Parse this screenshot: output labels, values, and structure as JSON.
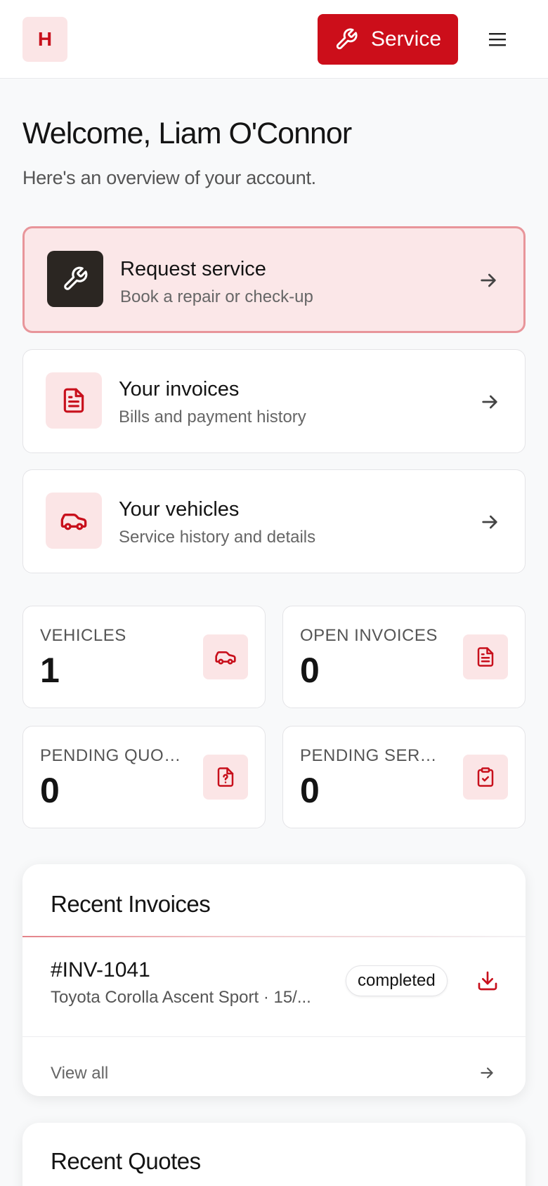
{
  "header": {
    "logo_letter": "H",
    "service_label": "Service"
  },
  "welcome": {
    "title": "Welcome, Liam O'Connor",
    "subtitle": "Here's an overview of your account."
  },
  "actions": [
    {
      "title": "Request service",
      "desc": "Book a repair or check-up",
      "icon": "wrench-icon"
    },
    {
      "title": "Your invoices",
      "desc": "Bills and payment history",
      "icon": "document-icon"
    },
    {
      "title": "Your vehicles",
      "desc": "Service history and details",
      "icon": "car-icon"
    }
  ],
  "stats": [
    {
      "label": "VEHICLES",
      "value": "1",
      "icon": "car-icon"
    },
    {
      "label": "OPEN INVOICES",
      "value": "0",
      "icon": "document-icon"
    },
    {
      "label": "PENDING QUOTES",
      "value": "0",
      "icon": "question-file-icon"
    },
    {
      "label": "PENDING SERVICES",
      "value": "0",
      "icon": "clipboard-check-icon"
    }
  ],
  "recent_invoices": {
    "title": "Recent Invoices",
    "items": [
      {
        "number": "#INV-1041",
        "description": "Toyota Corolla Ascent Sport · 15/...",
        "status": "completed"
      }
    ],
    "view_all": "View all"
  },
  "recent_quotes": {
    "title": "Recent Quotes"
  },
  "colors": {
    "accent": "#cc0e1a",
    "accent_soft": "#fbe5e6",
    "dark_icon_bg": "#2b2622"
  }
}
